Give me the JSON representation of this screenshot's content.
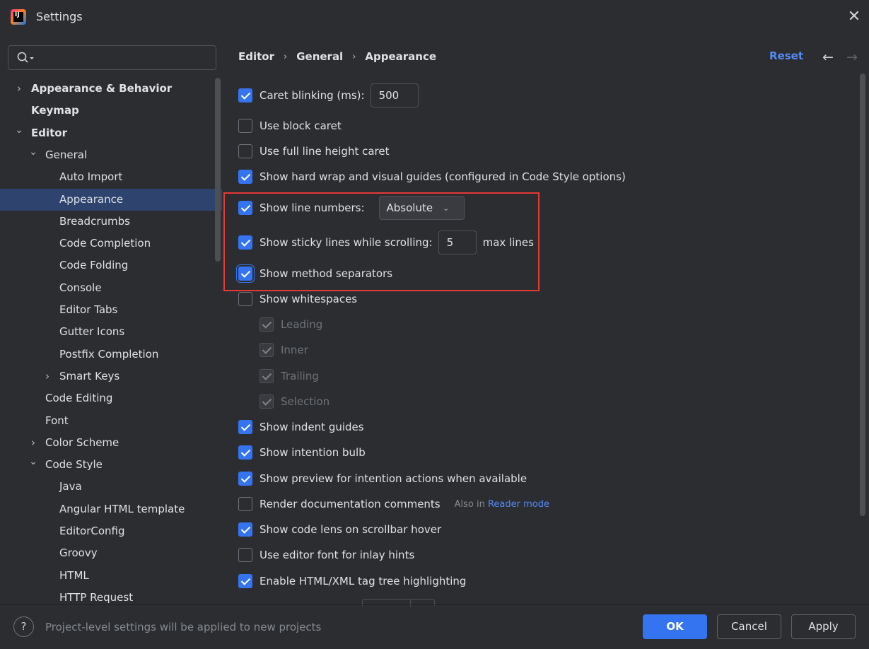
{
  "window": {
    "title": "Settings",
    "close": "✕"
  },
  "search": {
    "value": "",
    "placeholder": ""
  },
  "tree": [
    {
      "label": "Appearance & Behavior",
      "bold": true,
      "chevron": "right",
      "level": 0
    },
    {
      "label": "Keymap",
      "bold": true,
      "chevron": "",
      "level": 0
    },
    {
      "label": "Editor",
      "bold": true,
      "chevron": "down",
      "level": 0
    },
    {
      "label": "General",
      "bold": false,
      "chevron": "down",
      "level": 1
    },
    {
      "label": "Auto Import",
      "bold": false,
      "chevron": "",
      "level": 2
    },
    {
      "label": "Appearance",
      "bold": false,
      "chevron": "",
      "level": 2,
      "selected": true
    },
    {
      "label": "Breadcrumbs",
      "bold": false,
      "chevron": "",
      "level": 2
    },
    {
      "label": "Code Completion",
      "bold": false,
      "chevron": "",
      "level": 2
    },
    {
      "label": "Code Folding",
      "bold": false,
      "chevron": "",
      "level": 2
    },
    {
      "label": "Console",
      "bold": false,
      "chevron": "",
      "level": 2
    },
    {
      "label": "Editor Tabs",
      "bold": false,
      "chevron": "",
      "level": 2
    },
    {
      "label": "Gutter Icons",
      "bold": false,
      "chevron": "",
      "level": 2
    },
    {
      "label": "Postfix Completion",
      "bold": false,
      "chevron": "",
      "level": 2
    },
    {
      "label": "Smart Keys",
      "bold": false,
      "chevron": "right",
      "level": 2
    },
    {
      "label": "Code Editing",
      "bold": false,
      "chevron": "",
      "level": 1
    },
    {
      "label": "Font",
      "bold": false,
      "chevron": "",
      "level": 1
    },
    {
      "label": "Color Scheme",
      "bold": false,
      "chevron": "right",
      "level": 1
    },
    {
      "label": "Code Style",
      "bold": false,
      "chevron": "down",
      "level": 1
    },
    {
      "label": "Java",
      "bold": false,
      "chevron": "",
      "level": 2
    },
    {
      "label": "Angular HTML template",
      "bold": false,
      "chevron": "",
      "level": 2
    },
    {
      "label": "EditorConfig",
      "bold": false,
      "chevron": "",
      "level": 2
    },
    {
      "label": "Groovy",
      "bold": false,
      "chevron": "",
      "level": 2
    },
    {
      "label": "HTML",
      "bold": false,
      "chevron": "",
      "level": 2
    },
    {
      "label": "HTTP Request",
      "bold": false,
      "chevron": "",
      "level": 2
    }
  ],
  "breadcrumb": [
    "Editor",
    "General",
    "Appearance"
  ],
  "header": {
    "reset": "Reset",
    "back": "←",
    "forward": "→"
  },
  "options": {
    "caret_blinking": {
      "label": "Caret blinking (ms):",
      "checked": true,
      "value": "500"
    },
    "block_caret": {
      "label": "Use block caret",
      "checked": false
    },
    "full_line_caret": {
      "label": "Use full line height caret",
      "checked": false
    },
    "hard_wrap": {
      "label": "Show hard wrap and visual guides (configured in Code Style options)",
      "checked": true
    },
    "line_numbers": {
      "label": "Show line numbers:",
      "checked": true,
      "selected": "Absolute"
    },
    "sticky_lines": {
      "label": "Show sticky lines while scrolling:",
      "checked": true,
      "value": "5",
      "suffix": "max lines"
    },
    "method_separators": {
      "label": "Show method separators",
      "checked": true
    },
    "whitespaces": {
      "label": "Show whitespaces",
      "checked": false
    },
    "leading": {
      "label": "Leading",
      "checked": true
    },
    "inner": {
      "label": "Inner",
      "checked": true
    },
    "trailing": {
      "label": "Trailing",
      "checked": true
    },
    "selection": {
      "label": "Selection",
      "checked": true
    },
    "indent_guides": {
      "label": "Show indent guides",
      "checked": true
    },
    "intention_bulb": {
      "label": "Show intention bulb",
      "checked": true
    },
    "preview_intention": {
      "label": "Show preview for intention actions when available",
      "checked": true
    },
    "render_docs": {
      "label": "Render documentation comments",
      "checked": false,
      "hint": "Also in",
      "hint_link": "Reader mode"
    },
    "code_lens": {
      "label": "Show code lens on scrollbar hover",
      "checked": true
    },
    "inlay_font": {
      "label": "Use editor font for inlay hints",
      "checked": false
    },
    "tag_tree": {
      "label": "Enable HTML/XML tag tree highlighting",
      "checked": true
    }
  },
  "footer": {
    "help": "?",
    "note": "Project-level settings will be applied to new projects",
    "ok": "OK",
    "cancel": "Cancel",
    "apply": "Apply"
  },
  "colors": {
    "accent": "#3574f0",
    "link": "#548af7",
    "highlight": "#e53935",
    "selection": "#2e436e"
  }
}
